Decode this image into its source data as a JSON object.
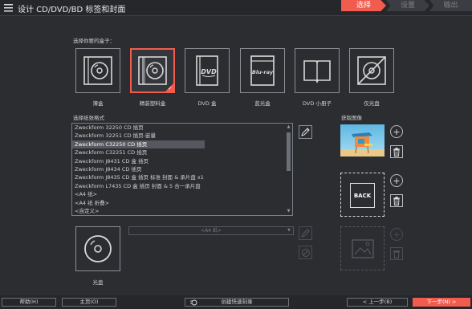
{
  "app": {
    "title": "设计 CD/DVD/BD 标签和封面"
  },
  "steps": [
    {
      "label": "选择",
      "state": "active"
    },
    {
      "label": "设置",
      "state": "inactive"
    },
    {
      "label": "输出",
      "state": "inactive"
    }
  ],
  "case_section": {
    "label": "选择你要的盒子：",
    "cases": [
      {
        "label": "薄盒",
        "icon": "thin-case-icon",
        "selected": false
      },
      {
        "label": "精装塑料盒",
        "icon": "jewel-case-icon",
        "selected": true
      },
      {
        "label": "DVD 盒",
        "icon": "dvd-case-icon",
        "selected": false
      },
      {
        "label": "蓝光盒",
        "icon": "bluray-case-icon",
        "selected": false
      },
      {
        "label": "DVD 小册子",
        "icon": "booklet-icon",
        "selected": false
      },
      {
        "label": "仅光盘",
        "icon": "disc-only-icon",
        "selected": false
      }
    ]
  },
  "paper_section": {
    "label": "选择纸张格式",
    "items": [
      "Zweckform 32250 CD 插页",
      "Zweckform 32251 CD 插页-嵌量",
      "Zweckform C32250 CD 插页",
      "Zweckform C32251 CD 插页",
      "Zweckform J8431 CD 盒 插页",
      "Zweckform J8434 CD 插页",
      "Zweckform J8435 CD 盒 插页 标准 封面 & 承片盘 x1",
      "Zweckform L7435 CD 盒 插页 封面 & 5 合一承片盘",
      "<A4 纸>",
      "<A4 纸 折叠>",
      "<自定义>"
    ],
    "selected_index": 2
  },
  "disc": {
    "label": "光盘",
    "size_placeholder": "<A4 纸>"
  },
  "image_section": {
    "label": "获取图像",
    "back_label": "BACK"
  },
  "bottom": {
    "help": "帮助(H)",
    "home": "主页(O)",
    "quick_burn": "创建快速刻录",
    "prev": "< 上一步(B)",
    "next": "下一步(N) >"
  },
  "colors": {
    "accent": "#f25c4f",
    "background": "#2b2d31",
    "bar": "#25272b"
  }
}
